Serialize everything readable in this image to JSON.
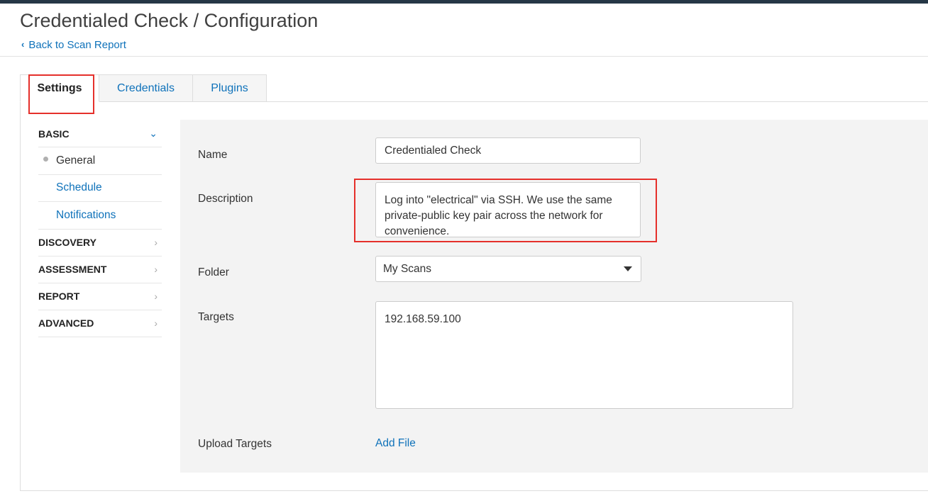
{
  "header": {
    "title": "Credentialed Check / Configuration",
    "back_label": "Back to Scan Report"
  },
  "tabs": [
    {
      "label": "Settings",
      "active": true
    },
    {
      "label": "Credentials",
      "active": false
    },
    {
      "label": "Plugins",
      "active": false
    }
  ],
  "sidenav": {
    "basic": "BASIC",
    "basic_items": [
      {
        "label": "General",
        "current": true
      },
      {
        "label": "Schedule",
        "current": false
      },
      {
        "label": "Notifications",
        "current": false
      }
    ],
    "discovery": "DISCOVERY",
    "assessment": "ASSESSMENT",
    "report": "REPORT",
    "advanced": "ADVANCED"
  },
  "form": {
    "name_label": "Name",
    "name_value": "Credentialed Check",
    "description_label": "Description",
    "description_value": "Log into \"electrical\" via SSH. We use the same private-public key pair across the network for convenience.",
    "folder_label": "Folder",
    "folder_value": "My Scans",
    "targets_label": "Targets",
    "targets_value": "192.168.59.100",
    "upload_label": "Upload Targets",
    "add_file_label": "Add File"
  },
  "colors": {
    "accent": "#0f72ba",
    "highlight": "#e5302b",
    "topbar": "#263746"
  }
}
